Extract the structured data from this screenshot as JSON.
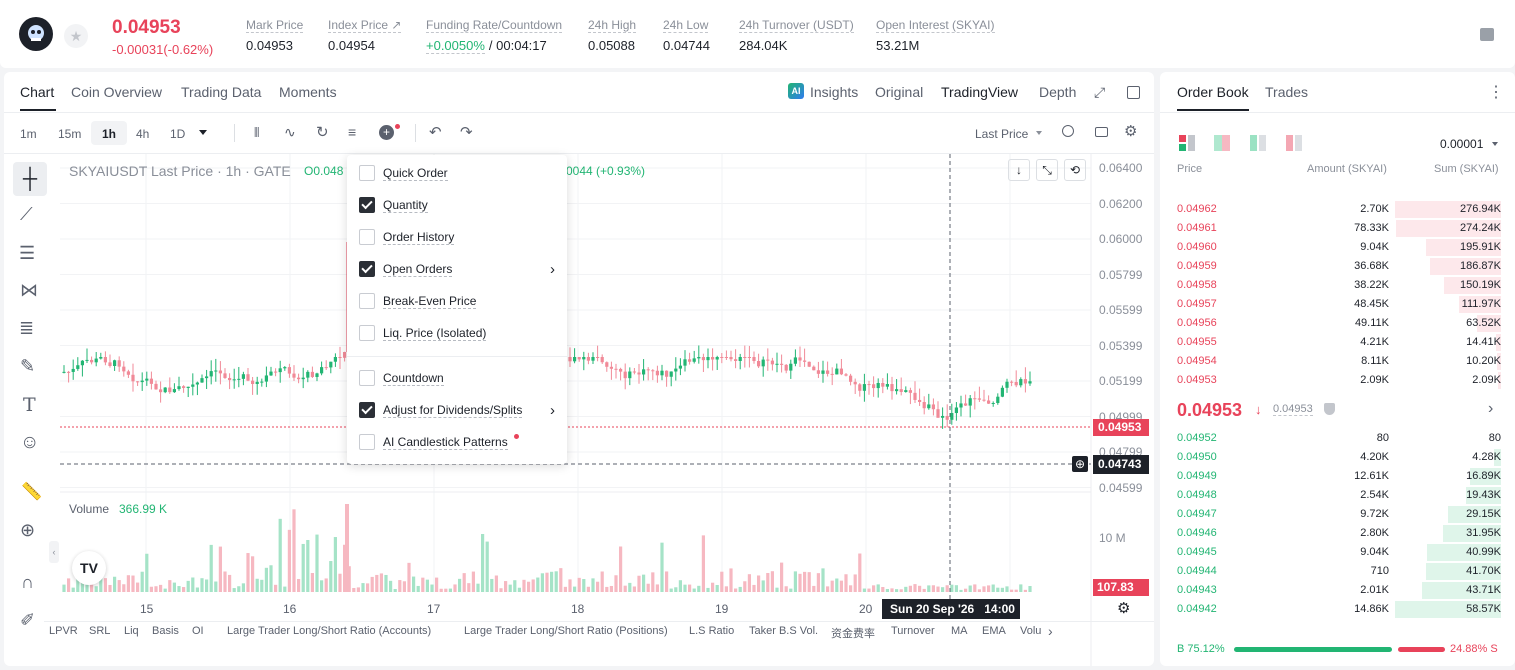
{
  "header": {
    "price": "0.04953",
    "change": "-0.00031(-0.62%)",
    "stats": [
      {
        "label": "Mark Price",
        "value": "0.04953"
      },
      {
        "label": "Index Price ↗",
        "value": "0.04954"
      },
      {
        "label": "Funding Rate/Countdown",
        "value": "+0.0050%",
        "value2": "/ 00:04:17"
      },
      {
        "label": "24h High",
        "value": "0.05088"
      },
      {
        "label": "24h Low",
        "value": "0.04744"
      },
      {
        "label": "24h Turnover (USDT)",
        "value": "284.04K"
      },
      {
        "label": "Open Interest (SKYAI)",
        "value": "53.21M"
      }
    ]
  },
  "chart_tabs": [
    "Chart",
    "Coin Overview",
    "Trading Data",
    "Moments"
  ],
  "view_tabs": {
    "insights": "Insights",
    "original": "Original",
    "tradingview": "TradingView",
    "depth": "Depth"
  },
  "intervals": [
    "1m",
    "15m",
    "1h",
    "4h",
    "1D"
  ],
  "price_type": "Last Price",
  "chart": {
    "symbol_line": "SKYAIUSDT Last Price · 1h · GATE",
    "ohlc_frag": "O0.048",
    "change_frag": "0044 (+0.93%)",
    "price_ticks": [
      "0.06400",
      "0.06200",
      "0.06000",
      "0.05799",
      "0.05599",
      "0.05399",
      "0.05199",
      "0.04999",
      "0.04799",
      "0.04599"
    ],
    "last_price_tag": "0.04953",
    "cursor_price_tag": "0.04743",
    "volume_label": "Volume",
    "volume_value": "366.99 K",
    "volume_tick": "10 M",
    "volume_tag": "107.83 K",
    "date_ticks": [
      "15",
      "16",
      "17",
      "18",
      "19",
      "20"
    ],
    "cursor_date": "Sun 20 Sep '26",
    "cursor_time": "14:00"
  },
  "menu": {
    "items": [
      {
        "label": "Quick Order",
        "checked": false,
        "arrow": false
      },
      {
        "label": "Quantity",
        "checked": true,
        "arrow": false
      },
      {
        "label": "Order History",
        "checked": false,
        "arrow": false
      },
      {
        "label": "Open Orders",
        "checked": true,
        "arrow": true
      },
      {
        "label": "Break-Even Price",
        "checked": false,
        "arrow": false
      },
      {
        "label": "Liq. Price (Isolated)",
        "checked": false,
        "arrow": false
      },
      {
        "label": "Countdown",
        "checked": false,
        "arrow": false
      },
      {
        "label": "Adjust for Dividends/Splits",
        "checked": true,
        "arrow": true
      },
      {
        "label": "AI Candlestick Patterns",
        "checked": false,
        "arrow": false
      }
    ]
  },
  "indicators": [
    "LPVR",
    "SRL",
    "Liq",
    "Basis",
    "OI",
    "Large Trader Long/Short Ratio (Accounts)",
    "Large Trader Long/Short Ratio (Positions)",
    "L.S Ratio",
    "Taker B.S Vol.",
    "资金费率",
    "Turnover",
    "MA",
    "EMA",
    "Volu"
  ],
  "orderbook": {
    "tabs": [
      "Order Book",
      "Trades"
    ],
    "precision": "0.00001",
    "headers": {
      "price": "Price",
      "amount": "Amount (SKYAI)",
      "sum": "Sum (SKYAI)"
    },
    "asks": [
      {
        "price": "0.04962",
        "amount": "2.70K",
        "sum": "276.94K",
        "depth": 1.0
      },
      {
        "price": "0.04961",
        "amount": "78.33K",
        "sum": "274.24K",
        "depth": 0.99
      },
      {
        "price": "0.04960",
        "amount": "9.04K",
        "sum": "195.91K",
        "depth": 0.71
      },
      {
        "price": "0.04959",
        "amount": "36.68K",
        "sum": "186.87K",
        "depth": 0.67
      },
      {
        "price": "0.04958",
        "amount": "38.22K",
        "sum": "150.19K",
        "depth": 0.54
      },
      {
        "price": "0.04957",
        "amount": "48.45K",
        "sum": "111.97K",
        "depth": 0.4
      },
      {
        "price": "0.04956",
        "amount": "49.11K",
        "sum": "63.52K",
        "depth": 0.23
      },
      {
        "price": "0.04955",
        "amount": "4.21K",
        "sum": "14.41K",
        "depth": 0.05
      },
      {
        "price": "0.04954",
        "amount": "8.11K",
        "sum": "10.20K",
        "depth": 0.04
      },
      {
        "price": "0.04953",
        "amount": "2.09K",
        "sum": "2.09K",
        "depth": 0.01
      }
    ],
    "mid_price": "0.04953",
    "mark_price": "0.04953",
    "bids": [
      {
        "price": "0.04952",
        "amount": "80",
        "sum": "80",
        "depth": 0.0
      },
      {
        "price": "0.04950",
        "amount": "4.20K",
        "sum": "4.28K",
        "depth": 0.07
      },
      {
        "price": "0.04949",
        "amount": "12.61K",
        "sum": "16.89K",
        "depth": 0.29
      },
      {
        "price": "0.04948",
        "amount": "2.54K",
        "sum": "19.43K",
        "depth": 0.33
      },
      {
        "price": "0.04947",
        "amount": "9.72K",
        "sum": "29.15K",
        "depth": 0.5
      },
      {
        "price": "0.04946",
        "amount": "2.80K",
        "sum": "31.95K",
        "depth": 0.55
      },
      {
        "price": "0.04945",
        "amount": "9.04K",
        "sum": "40.99K",
        "depth": 0.7
      },
      {
        "price": "0.04944",
        "amount": "710",
        "sum": "41.70K",
        "depth": 0.71
      },
      {
        "price": "0.04943",
        "amount": "2.01K",
        "sum": "43.71K",
        "depth": 0.75
      },
      {
        "price": "0.04942",
        "amount": "14.86K",
        "sum": "58.57K",
        "depth": 1.0
      }
    ],
    "buy_ratio": "B 75.12%",
    "sell_ratio": "24.88% S",
    "buy_fraction": 0.7512
  },
  "colors": {
    "up": "#22b573",
    "down": "#e8435a",
    "accent": "#1d2129"
  }
}
